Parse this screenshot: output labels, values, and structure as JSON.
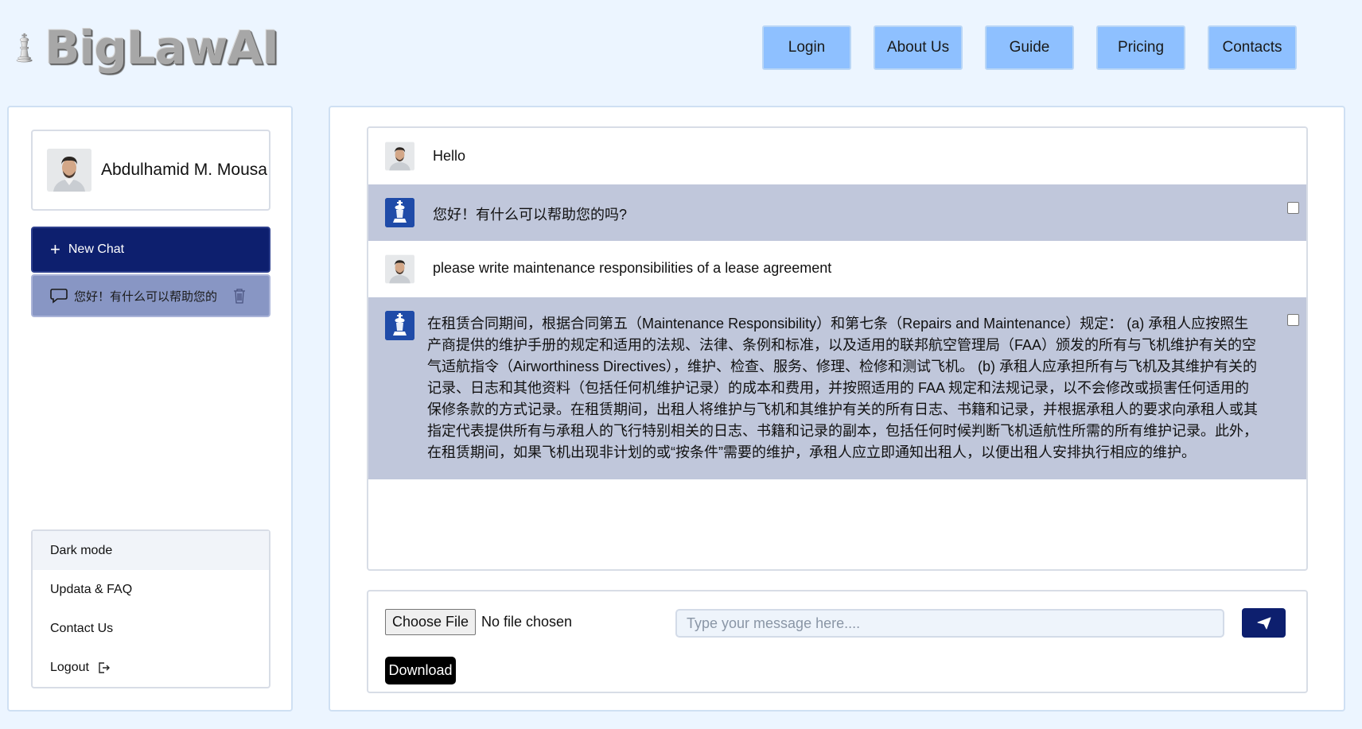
{
  "brand": {
    "name": "BigLawAI"
  },
  "topnav": [
    {
      "label": "Login"
    },
    {
      "label": "About Us"
    },
    {
      "label": "Guide"
    },
    {
      "label": "Pricing"
    },
    {
      "label": "Contacts"
    }
  ],
  "sidebar": {
    "user_name": "Abdulhamid M. Mousa",
    "new_chat_label": "New Chat",
    "history": [
      {
        "label": "您好！有什么可以帮助您的"
      }
    ],
    "menu": [
      {
        "label": "Dark mode"
      },
      {
        "label": "Updata & FAQ"
      },
      {
        "label": "Contact Us"
      },
      {
        "label": "Logout"
      }
    ]
  },
  "chat": {
    "messages": [
      {
        "role": "user",
        "text": "Hello"
      },
      {
        "role": "bot",
        "text": "您好！有什么可以帮助您的吗?"
      },
      {
        "role": "user",
        "text": "please write maintenance responsibilities of a lease agreement"
      },
      {
        "role": "bot",
        "text": "在租赁合同期间，根据合同第五（Maintenance Responsibility）和第七条（Repairs and Maintenance）规定： (a) 承租人应按照生产商提供的维护手册的规定和适用的法规、法律、条例和标准，以及适用的联邦航空管理局（FAA）颁发的所有与飞机维护有关的空气适航指令（Airworthiness Directives），维护、检查、服务、修理、检修和测试飞机。 (b) 承租人应承担所有与飞机及其维护有关的记录、日志和其他资料（包括任何机维护记录）的成本和费用，并按照适用的 FAA 规定和法规记录，以不会修改或损害任何适用的保修条款的方式记录。在租赁期间，出租人将维护与飞机和其维护有关的所有日志、书籍和记录，并根据承租人的要求向承租人或其指定代表提供所有与承租人的飞行特别相关的日志、书籍和记录的副本，包括任何时候判断飞机适航性所需的所有维护记录。此外，在租赁期间，如果飞机出现非计划的或“按条件”需要的维护，承租人应立即通知出租人，以便出租人安排执行相应的维护。"
      }
    ]
  },
  "input": {
    "file_button": "Choose File",
    "file_status": "No file chosen",
    "placeholder": "Type your message here....",
    "download_label": "Download"
  },
  "colors": {
    "background": "#ecf5ff",
    "nav_button": "#8ec0ff",
    "primary_dark": "#0d1f6e",
    "history_item": "#8896c4",
    "bot_message_bg": "#c0c7db"
  },
  "icons": {
    "logo": "chess-king-icon",
    "new_chat": "plus-icon",
    "history": "chat-bubble-icon",
    "delete": "trash-icon",
    "logout": "logout-icon",
    "send": "paper-plane-icon"
  }
}
